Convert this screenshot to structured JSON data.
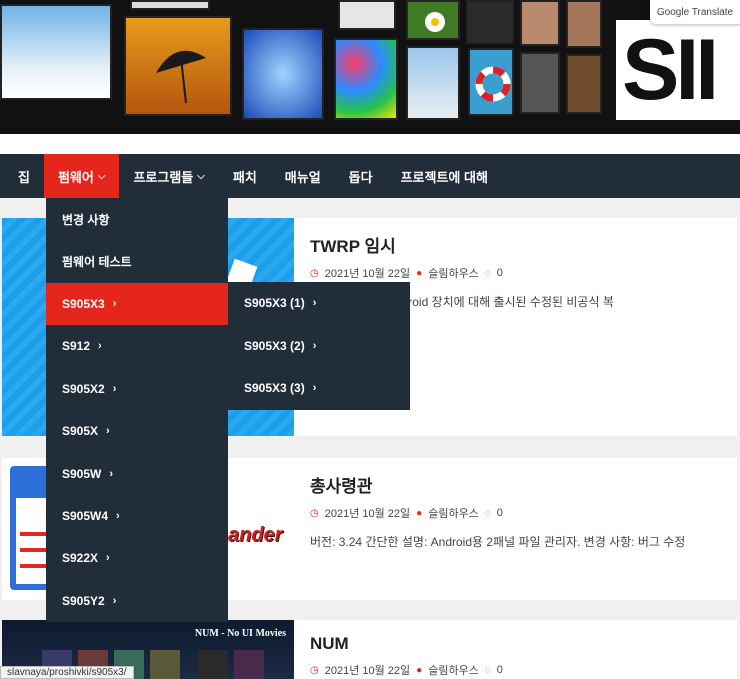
{
  "banner": {
    "translate_badge": "Google Translate",
    "brand_text": "SII"
  },
  "nav": {
    "items": [
      {
        "label": "집",
        "has_caret": false
      },
      {
        "label": "펌웨어",
        "has_caret": true
      },
      {
        "label": "프로그램들",
        "has_caret": true
      },
      {
        "label": "패치",
        "has_caret": false
      },
      {
        "label": "매뉴얼",
        "has_caret": false
      },
      {
        "label": "돕다",
        "has_caret": false
      },
      {
        "label": "프로젝트에 대해",
        "has_caret": false
      }
    ],
    "caret": "⌵"
  },
  "firmware_menu": {
    "items": [
      {
        "label": "변경 사항",
        "has_chevron": false
      },
      {
        "label": "펌웨어 테스트",
        "has_chevron": false
      },
      {
        "label": "S905X3",
        "has_chevron": true
      },
      {
        "label": "S912",
        "has_chevron": true
      },
      {
        "label": "S905X2",
        "has_chevron": true
      },
      {
        "label": "S905X",
        "has_chevron": true
      },
      {
        "label": "S905W",
        "has_chevron": true
      },
      {
        "label": "S905W4",
        "has_chevron": true
      },
      {
        "label": "S922X",
        "has_chevron": true
      },
      {
        "label": "S905Y2",
        "has_chevron": true
      }
    ],
    "chevron": "›"
  },
  "s905x3_submenu": {
    "items": [
      {
        "label": "S905X3 (1)"
      },
      {
        "label": "S905X3 (2)"
      },
      {
        "label": "S905X3 (3)"
      }
    ]
  },
  "posts": [
    {
      "title": "TWRP 임시",
      "date": "2021년 10월 22일",
      "author": "슬림하우스",
      "comments": "0",
      "excerpt": "구)는 대부분의 Android 장치에 대해 출시된 수정된 비공식 복"
    },
    {
      "title": "총사령관",
      "date": "2021년 10월 22일",
      "author": "슬림하우스",
      "comments": "0",
      "excerpt": "버전: 3.24 간단한 설명: Android용 2패널 파일 관리자. 변경 사항: 버그 수정",
      "thumb_text": "ander"
    },
    {
      "title": "NUM",
      "date": "2021년 10월 22일",
      "author": "슬림하우스",
      "comments": "0",
      "excerpt": "",
      "thumb_text": "NUM - No UI Movies"
    }
  ],
  "icons": {
    "clock": "◷",
    "user": "●",
    "comment": "◌"
  },
  "status_url": "slavnaya/proshivki/s905x3/",
  "colors": {
    "accent": "#e4261c",
    "nav_bg": "#222d3a"
  }
}
